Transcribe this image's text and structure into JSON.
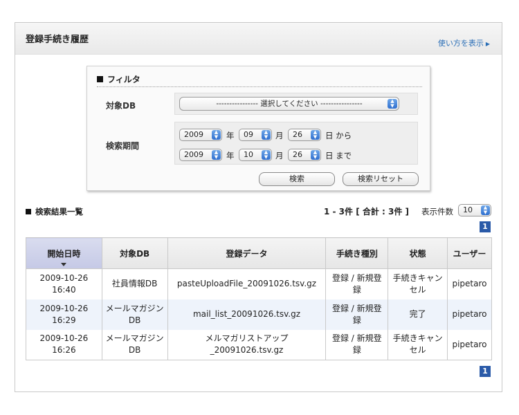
{
  "header": {
    "title": "登録手続き履歴",
    "help_link": "使い方を表示",
    "help_icon": "triangle-right-icon"
  },
  "filter": {
    "heading": "フィルタ",
    "db_label": "対象DB",
    "db_select_value": "---------------- 選択してください ----------------",
    "period_label": "検索期間",
    "from": {
      "year": "2009",
      "month": "09",
      "day": "26"
    },
    "to": {
      "year": "2009",
      "month": "10",
      "day": "26"
    },
    "unit_year": "年",
    "unit_month": "月",
    "unit_day_from": "日 から",
    "unit_day_to": "日 まで",
    "search_button": "検索",
    "reset_button": "検索リセット"
  },
  "results": {
    "title": "検索結果一覧",
    "count_text": "1 - 3件 [ 合計 : 3件 ]",
    "per_page_label": "表示件数",
    "per_page_value": "10",
    "page_top": "1",
    "page_bottom": "1",
    "columns": [
      "開始日時",
      "対象DB",
      "登録データ",
      "手続き種別",
      "状態",
      "ユーザー"
    ],
    "rows": [
      {
        "date": "2009-10-26",
        "time": "16:40",
        "db1": "社員情報DB",
        "db2": "",
        "data1": "pasteUploadFile_20091026.tsv.gz",
        "data2": "",
        "type1": "登録 / 新規登",
        "type2": "録",
        "status1": "手続きキャン",
        "status2": "セル",
        "user": "pipetaro"
      },
      {
        "date": "2009-10-26",
        "time": "16:29",
        "db1": "メールマガジン",
        "db2": "DB",
        "data1": "mail_list_20091026.tsv.gz",
        "data2": "",
        "type1": "登録 / 新規登",
        "type2": "録",
        "status1": "完了",
        "status2": "",
        "user": "pipetaro"
      },
      {
        "date": "2009-10-26",
        "time": "16:26",
        "db1": "メールマガジン",
        "db2": "DB",
        "data1": "メルマガリストアップ",
        "data2": "_20091026.tsv.gz",
        "type1": "登録 / 新規登",
        "type2": "録",
        "status1": "手続きキャン",
        "status2": "セル",
        "user": "pipetaro"
      }
    ]
  },
  "colors": {
    "accent": "#2a5aa8",
    "link": "#2a6eb6",
    "sorted_header": "#c5c9e6",
    "row_alt": "#eef3fb"
  }
}
